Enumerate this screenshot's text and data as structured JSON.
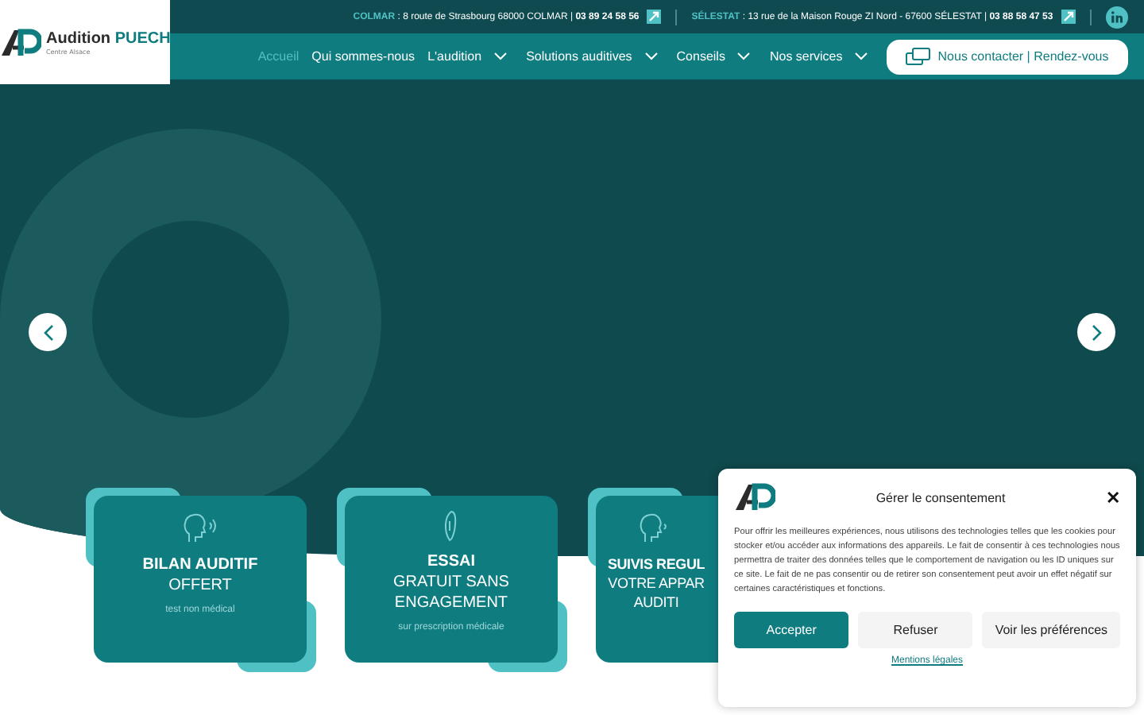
{
  "logo": {
    "brand_first": "Audition",
    "brand_second": "PUECH",
    "tagline": "Centre Alsace"
  },
  "contacts": [
    {
      "city": "COLMAR",
      "address": ": 8 route de Strasbourg 68000 COLMAR |",
      "phone": "03 89 24 58 56"
    },
    {
      "city": "SÉLESTAT",
      "address": ": 13 rue de la Maison Rouge ZI Nord - 67600 SÉLESTAT |",
      "phone": "03 88 58 47 53"
    }
  ],
  "nav": [
    {
      "label": "Accueil",
      "selected": true,
      "has_menu": false
    },
    {
      "label": "Qui sommes-nous",
      "selected": false,
      "has_menu": false
    },
    {
      "label": "L'audition",
      "selected": false,
      "has_menu": true
    },
    {
      "label": "Solutions auditives",
      "selected": false,
      "has_menu": true
    },
    {
      "label": "Conseils",
      "selected": false,
      "has_menu": true
    },
    {
      "label": "Nos services",
      "selected": false,
      "has_menu": true
    }
  ],
  "contact_button": "Nous contacter | Rendez-vous",
  "cards": [
    {
      "kind": "listening",
      "title": "BILAN AUDITIF",
      "lines": [
        "OFFERT"
      ],
      "note": "test non médical"
    },
    {
      "kind": "hearing-aid",
      "title": "ESSAI",
      "lines": [
        "GRATUIT SANS",
        "ENGAGEMENT"
      ],
      "note": "sur prescription médicale"
    },
    {
      "kind": "speaking",
      "title": "SUIVIS REGUL",
      "lines": [
        "VOTRE APPAR",
        "AUDITI"
      ]
    }
  ],
  "consent": {
    "title": "Gérer le consentement",
    "close": "✕",
    "text": "Pour offrir les meilleures expériences, nous utilisons des technologies telles que les cookies pour stocker et/ou accéder aux informations des appareils. Le fait de consentir à ces technologies nous permettra de traiter des données telles que le comportement de navigation ou les ID uniques sur ce site. Le fait de ne pas consentir ou de retirer son consentement peut avoir un effet négatif sur certaines caractéristiques et fonctions.",
    "buttons": [
      {
        "label": "Accepter",
        "primary": true
      },
      {
        "label": "Refuser",
        "primary": false
      },
      {
        "label": "Voir les préférences",
        "primary": false
      }
    ],
    "link": "Mentions légales"
  }
}
